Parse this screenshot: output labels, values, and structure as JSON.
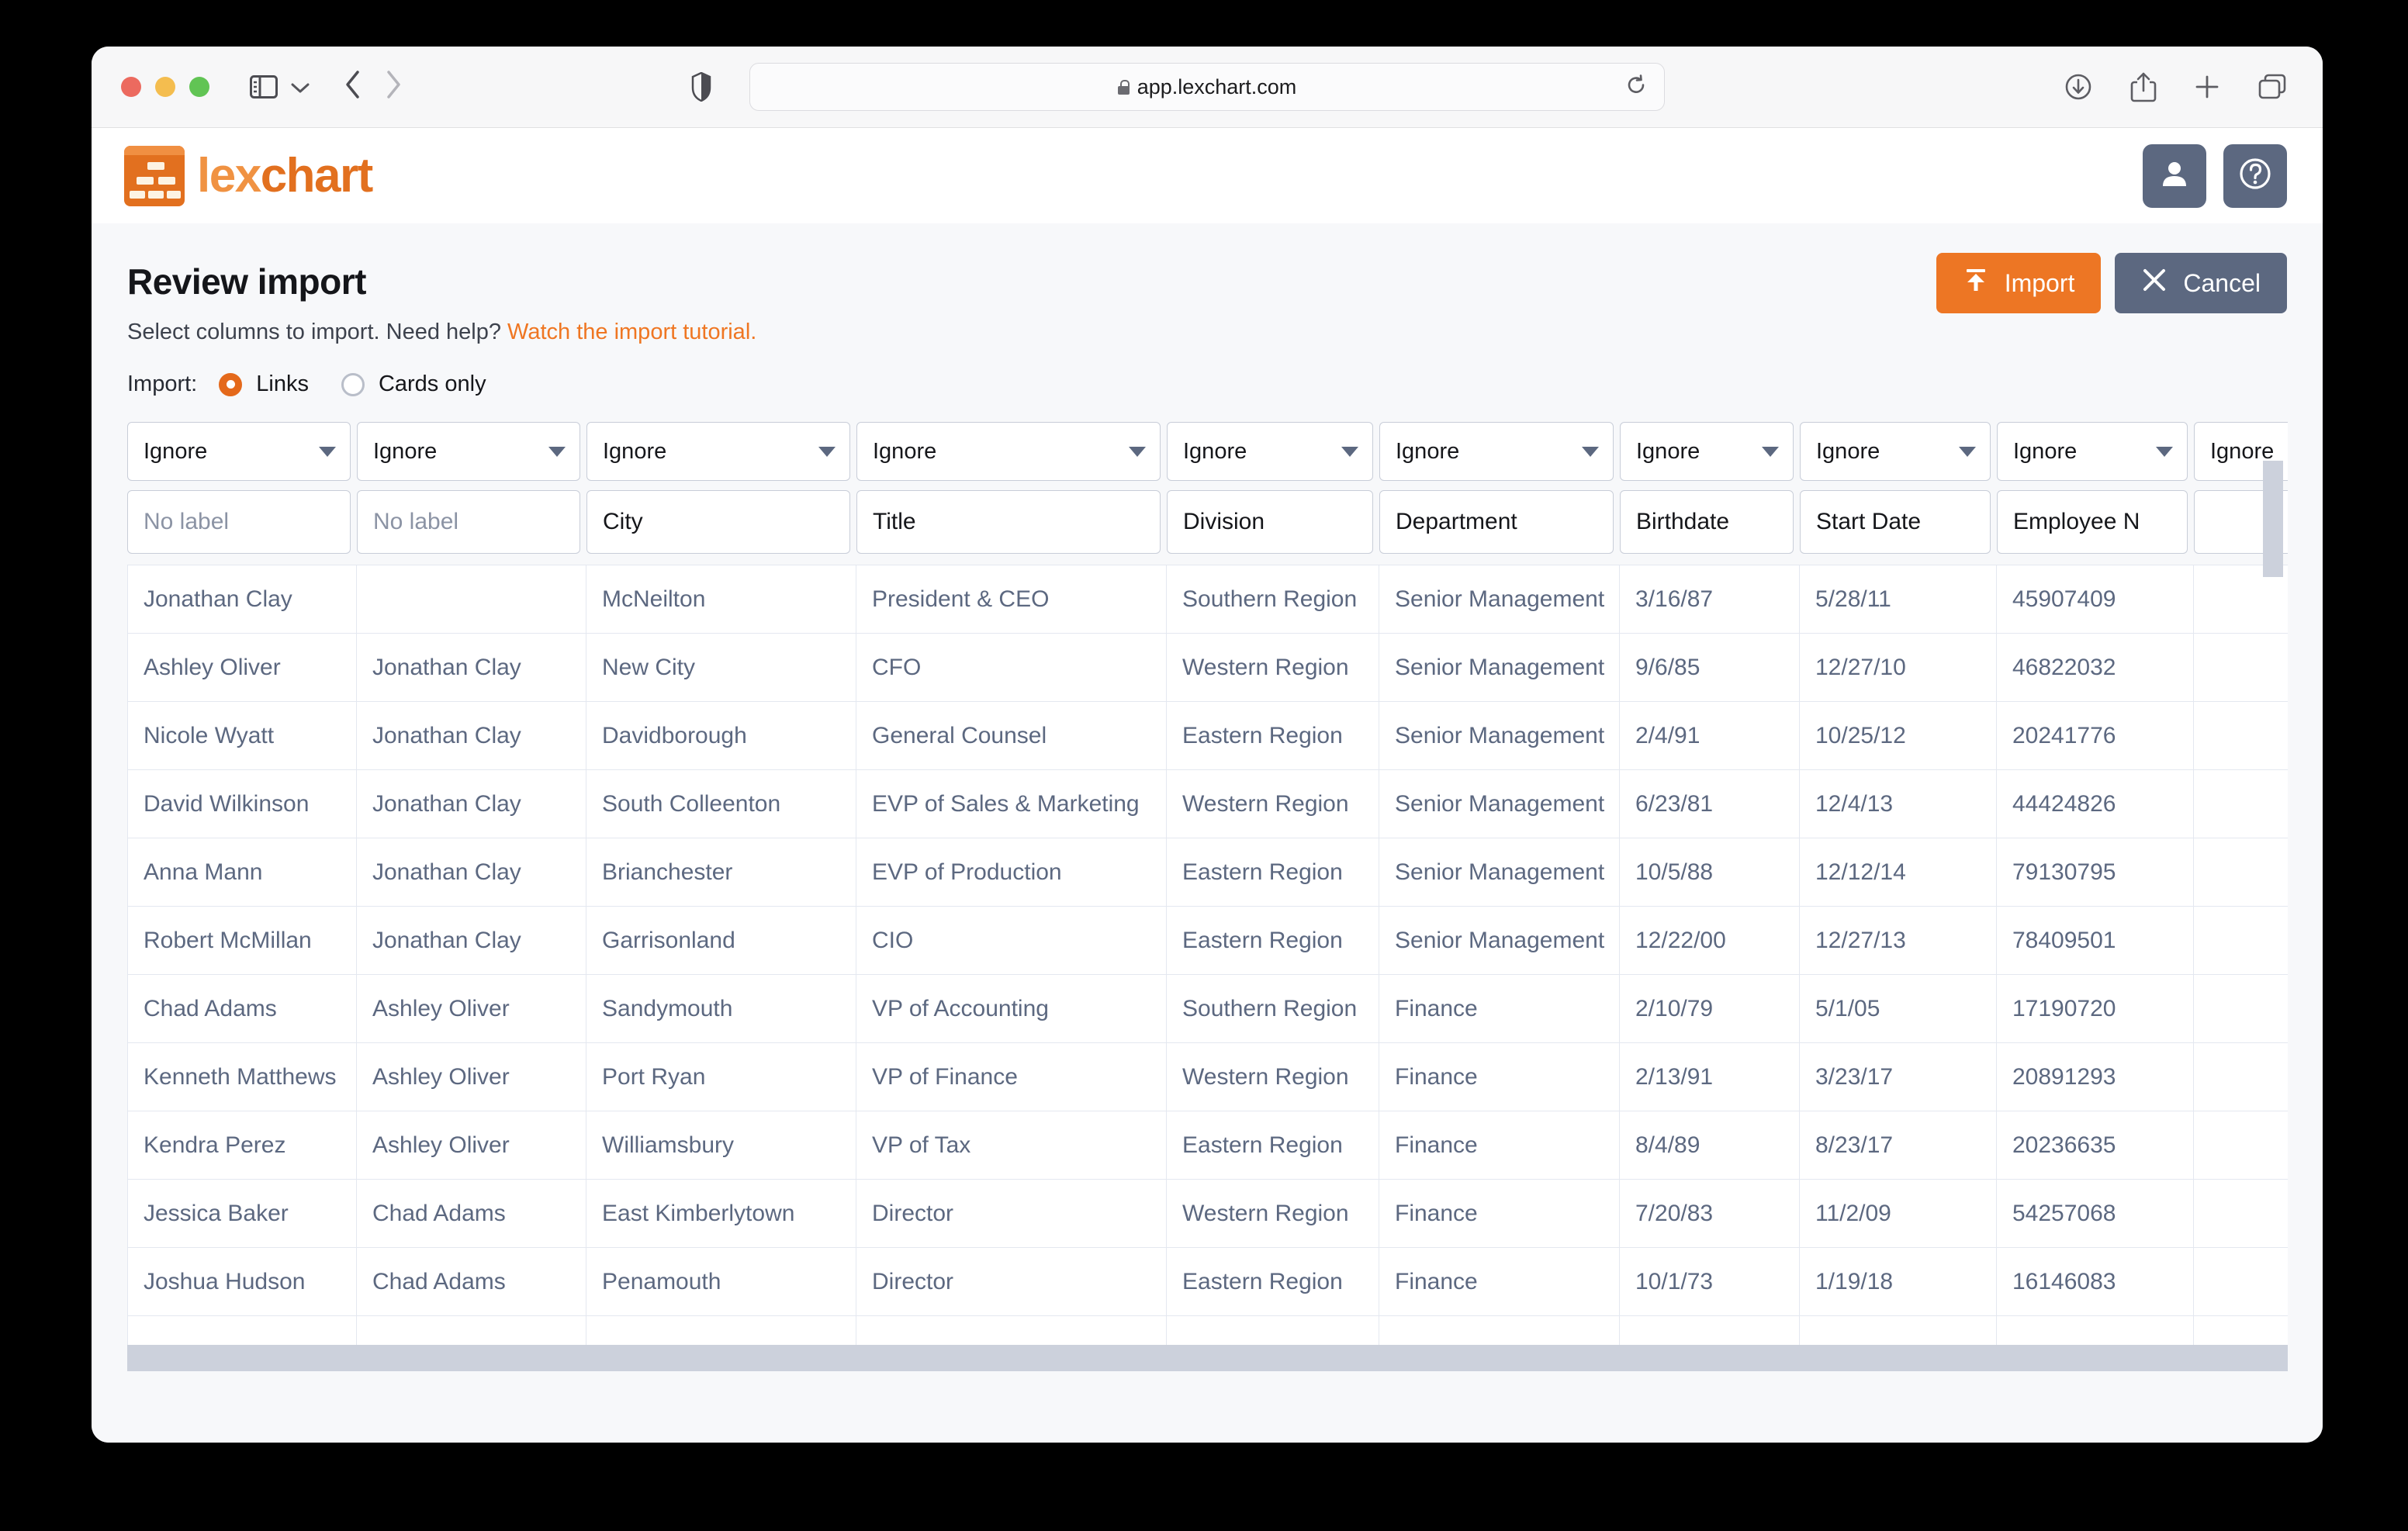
{
  "browser": {
    "url": "app.lexchart.com",
    "traffic_lights": [
      "close",
      "minimize",
      "maximize"
    ],
    "icons": {
      "sidebar": "sidebar-icon",
      "sidebar_chevron": "chevron-down-icon",
      "back": "back-arrow-icon",
      "forward": "forward-arrow-icon",
      "shield": "shield-icon",
      "lock": "lock-icon",
      "reload": "reload-icon",
      "downloads": "download-icon",
      "share": "share-icon",
      "new_tab": "plus-icon",
      "tab_overview": "tab-overview-icon"
    }
  },
  "app": {
    "brand_prefix": "lex",
    "brand_suffix": "chart",
    "brand_color": "#e2701f",
    "brand_light": "#f09242",
    "account_icon": "person-icon",
    "help_icon": "question-mark-icon"
  },
  "page": {
    "title": "Review import",
    "subtitle_text": "Select columns to import. Need help?",
    "subtitle_link": "Watch the import tutorial.",
    "import_label": "Import:",
    "options": [
      {
        "label": "Links",
        "selected": true
      },
      {
        "label": "Cards only",
        "selected": false
      }
    ],
    "buttons": {
      "import": "Import",
      "cancel": "Cancel",
      "import_icon": "upload-icon",
      "cancel_icon": "close-icon"
    }
  },
  "table": {
    "mapping_default": "Ignore",
    "label_placeholder": "No label",
    "columns": [
      {
        "mapping": "Ignore",
        "label": "",
        "is_placeholder": true
      },
      {
        "mapping": "Ignore",
        "label": "",
        "is_placeholder": true
      },
      {
        "mapping": "Ignore",
        "label": "City",
        "is_placeholder": false
      },
      {
        "mapping": "Ignore",
        "label": "Title",
        "is_placeholder": false
      },
      {
        "mapping": "Ignore",
        "label": "Division",
        "is_placeholder": false
      },
      {
        "mapping": "Ignore",
        "label": "Department",
        "is_placeholder": false
      },
      {
        "mapping": "Ignore",
        "label": "Birthdate",
        "is_placeholder": false
      },
      {
        "mapping": "Ignore",
        "label": "Start Date",
        "is_placeholder": false
      },
      {
        "mapping": "Ignore",
        "label": "Employee N",
        "is_placeholder": false
      },
      {
        "mapping": "Ignore",
        "label": "",
        "is_placeholder": false
      }
    ],
    "rows": [
      [
        "Jonathan Clay",
        "",
        "McNeilton",
        "President & CEO",
        "Southern Region",
        "Senior Management",
        "3/16/87",
        "5/28/11",
        "45907409",
        ""
      ],
      [
        "Ashley Oliver",
        "Jonathan Clay",
        "New City",
        "CFO",
        "Western Region",
        "Senior Management",
        "9/6/85",
        "12/27/10",
        "46822032",
        ""
      ],
      [
        "Nicole Wyatt",
        "Jonathan Clay",
        "Davidborough",
        "General Counsel",
        "Eastern Region",
        "Senior Management",
        "2/4/91",
        "10/25/12",
        "20241776",
        ""
      ],
      [
        "David Wilkinson",
        "Jonathan Clay",
        "South Colleenton",
        "EVP of Sales & Marketing",
        "Western Region",
        "Senior Management",
        "6/23/81",
        "12/4/13",
        "44424826",
        ""
      ],
      [
        "Anna Mann",
        "Jonathan Clay",
        "Brianchester",
        "EVP of Production",
        "Eastern Region",
        "Senior Management",
        "10/5/88",
        "12/12/14",
        "79130795",
        ""
      ],
      [
        "Robert McMillan",
        "Jonathan Clay",
        "Garrisonland",
        "CIO",
        "Eastern Region",
        "Senior Management",
        "12/22/00",
        "12/27/13",
        "78409501",
        ""
      ],
      [
        "Chad Adams",
        "Ashley Oliver",
        "Sandymouth",
        "VP of Accounting",
        "Southern Region",
        "Finance",
        "2/10/79",
        "5/1/05",
        "17190720",
        ""
      ],
      [
        "Kenneth Matthews",
        "Ashley Oliver",
        "Port Ryan",
        "VP of Finance",
        "Western Region",
        "Finance",
        "2/13/91",
        "3/23/17",
        "20891293",
        ""
      ],
      [
        "Kendra Perez",
        "Ashley Oliver",
        "Williamsbury",
        "VP of Tax",
        "Eastern Region",
        "Finance",
        "8/4/89",
        "8/23/17",
        "20236635",
        ""
      ],
      [
        "Jessica Baker",
        "Chad Adams",
        "East Kimberlytown",
        "Director",
        "Western Region",
        "Finance",
        "7/20/83",
        "11/2/09",
        "54257068",
        ""
      ],
      [
        "Joshua Hudson",
        "Chad Adams",
        "Penamouth",
        "Director",
        "Eastern Region",
        "Finance",
        "10/1/73",
        "1/19/18",
        "16146083",
        ""
      ],
      [
        "",
        "",
        "",
        "",
        "",
        "",
        "",
        "",
        "",
        ""
      ]
    ]
  }
}
